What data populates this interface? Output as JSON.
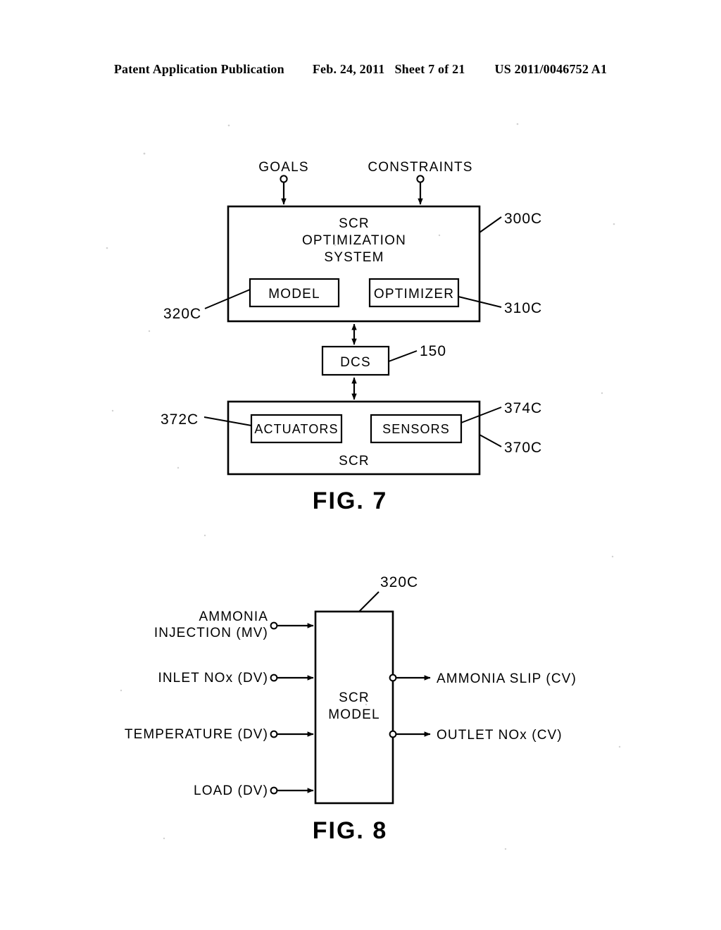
{
  "header": {
    "publication": "Patent Application Publication",
    "date": "Feb. 24, 2011",
    "sheet": "Sheet 7 of 21",
    "number": "US 2011/0046752 A1"
  },
  "figures": [
    {
      "caption": "FIG. 7",
      "inputs": [
        {
          "label": "GOALS",
          "terminal": "open-circle"
        },
        {
          "label": "CONSTRAINTS",
          "terminal": "open-circle"
        }
      ],
      "blocks": [
        {
          "name": "scr-optimization-system",
          "label": "SCR OPTIMIZATION SYSTEM",
          "label_lines": [
            "SCR",
            "OPTIMIZATION",
            "SYSTEM"
          ],
          "ref": "300C"
        },
        {
          "name": "model",
          "label": "MODEL",
          "ref": "320C"
        },
        {
          "name": "optimizer",
          "label": "OPTIMIZER",
          "ref": "310C"
        },
        {
          "name": "dcs",
          "label": "DCS",
          "ref": "150"
        },
        {
          "name": "scr",
          "label": "SCR",
          "ref": "370C"
        },
        {
          "name": "actuators",
          "label": "ACTUATORS",
          "ref": "372C"
        },
        {
          "name": "sensors",
          "label": "SENSORS",
          "ref": "374C"
        }
      ]
    },
    {
      "caption": "FIG. 8",
      "block": {
        "name": "scr-model",
        "label_lines": [
          "SCR",
          "MODEL"
        ],
        "ref": "320C"
      },
      "inputs": [
        {
          "label_lines": [
            "AMMONIA",
            "INJECTION (MV)"
          ],
          "label": "AMMONIA INJECTION (MV)",
          "terminal": "open-circle"
        },
        {
          "label_lines": [
            "INLET NOx (DV)"
          ],
          "label": "INLET NOx (DV)",
          "terminal": "open-circle"
        },
        {
          "label_lines": [
            "TEMPERATURE (DV)"
          ],
          "label": "TEMPERATURE (DV)",
          "terminal": "open-circle"
        },
        {
          "label_lines": [
            "LOAD (DV)"
          ],
          "label": "LOAD (DV)",
          "terminal": "open-circle"
        }
      ],
      "outputs": [
        {
          "label": "AMMONIA SLIP (CV)",
          "terminal": "open-circle"
        },
        {
          "label": "OUTLET NOx (CV)",
          "terminal": "open-circle"
        }
      ]
    }
  ],
  "colors": {
    "ink": "#000000",
    "paper": "#ffffff"
  }
}
